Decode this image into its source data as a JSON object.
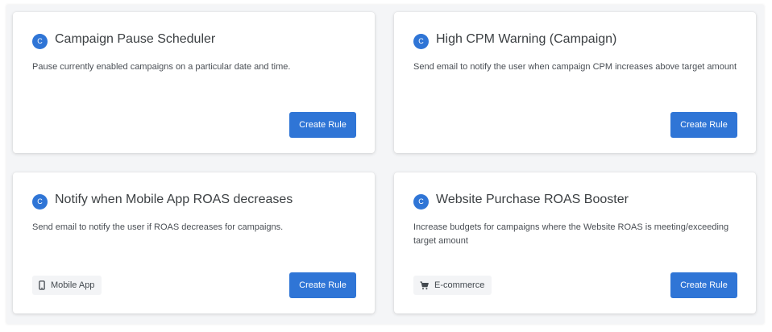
{
  "cards": [
    {
      "badge": "C",
      "title": "Campaign Pause Scheduler",
      "description": "Pause currently enabled campaigns on a particular date and time.",
      "button_label": "Create Rule"
    },
    {
      "badge": "C",
      "title": "High CPM Warning (Campaign)",
      "description": "Send email to notify the user when campaign CPM increases above target amount",
      "button_label": "Create Rule"
    },
    {
      "badge": "C",
      "title": "Notify when Mobile App ROAS decreases",
      "description": "Send email to notify the user if ROAS decreases for campaigns.",
      "button_label": "Create Rule",
      "tag": {
        "label": "Mobile App",
        "icon": "mobile-phone-icon"
      }
    },
    {
      "badge": "C",
      "title": "Website Purchase ROAS Booster",
      "description": "Increase budgets for campaigns where the Website ROAS is meeting/exceeding target amount",
      "button_label": "Create Rule",
      "tag": {
        "label": "E-commerce",
        "icon": "shopping-cart-icon"
      }
    }
  ],
  "colors": {
    "accent": "#2f75d6",
    "card_background": "#ffffff",
    "page_background": "#f4f5f7",
    "title_text": "#3c4043",
    "body_text": "#4a4f55",
    "tag_background": "#f3f4f6"
  }
}
